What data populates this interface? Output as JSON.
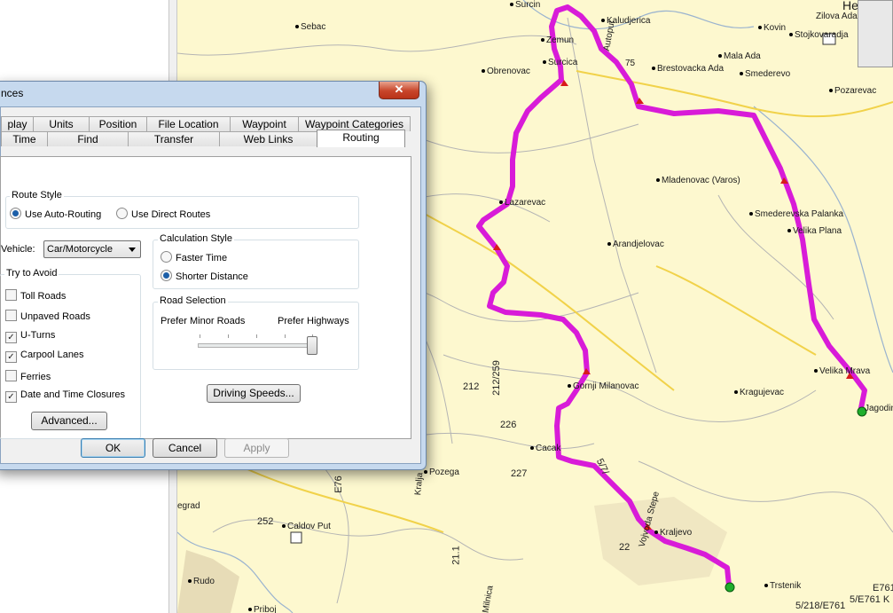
{
  "dialog": {
    "title": "nces",
    "close_glyph": "✕",
    "tabs_row1": [
      "play",
      "Units",
      "Position",
      "File Location",
      "Waypoint",
      "Waypoint Categories"
    ],
    "tabs_row2": [
      "Time",
      "Find",
      "Transfer",
      "Web Links",
      "Routing"
    ],
    "active_tab": "Routing",
    "route_style": {
      "label": "Route Style",
      "options": [
        "Use Auto-Routing",
        "Use Direct Routes"
      ],
      "selected": "Use Auto-Routing"
    },
    "vehicle": {
      "label": "Vehicle:",
      "value": "Car/Motorcycle"
    },
    "try_to_avoid": {
      "label": "Try to Avoid",
      "items": [
        {
          "label": "Toll Roads",
          "checked": false
        },
        {
          "label": "Unpaved Roads",
          "checked": false
        },
        {
          "label": "U-Turns",
          "checked": true
        },
        {
          "label": "Carpool Lanes",
          "checked": true
        },
        {
          "label": "Ferries",
          "checked": false
        },
        {
          "label": "Date and Time Closures",
          "checked": true
        }
      ],
      "advanced_label": "Advanced..."
    },
    "calculation_style": {
      "label": "Calculation Style",
      "options": [
        "Faster Time",
        "Shorter Distance"
      ],
      "selected": "Shorter Distance"
    },
    "road_selection": {
      "label": "Road Selection",
      "left_label": "Prefer Minor Roads",
      "right_label": "Prefer Highways",
      "slider_value": 1.0
    },
    "driving_speeds_label": "Driving Speeds...",
    "buttons": {
      "ok": "OK",
      "cancel": "Cancel",
      "apply": "Apply"
    },
    "check_glyph": "✓"
  },
  "map": {
    "route_color": "#e020e0",
    "background_color": "#fdf8cf",
    "cities": [
      "Surcin",
      "Zemun",
      "Surcica",
      "Obrenovac",
      "Autoput",
      "Kaludjerica",
      "Brestovacka Ada",
      "Mala Ada",
      "Smederevo",
      "Kovin",
      "Stojkovaradja",
      "Zilova Ada",
      "Pozarevac",
      "Sebac",
      "Mladenovac (Varos)",
      "Smederevska Palanka",
      "Velika Plana",
      "Lazarevac",
      "Arandjelovac",
      "Gornji Milanovac",
      "Kragujevac",
      "Velika Mrava",
      "Jagodina",
      "Cacak",
      "Pozega",
      "Kraljevo",
      "Vojvoda Stepe",
      "Trstenik",
      "Caldov Put",
      "Rudo",
      "Priboj",
      "Kralja",
      "Milnica",
      "egrad",
      "75",
      "He"
    ],
    "road_numbers": [
      "212",
      "212/259",
      "226",
      "227",
      "252",
      "22",
      "21.1",
      "5/218/E761",
      "5/E761 K",
      "E761",
      "E76",
      "5/7/"
    ]
  }
}
